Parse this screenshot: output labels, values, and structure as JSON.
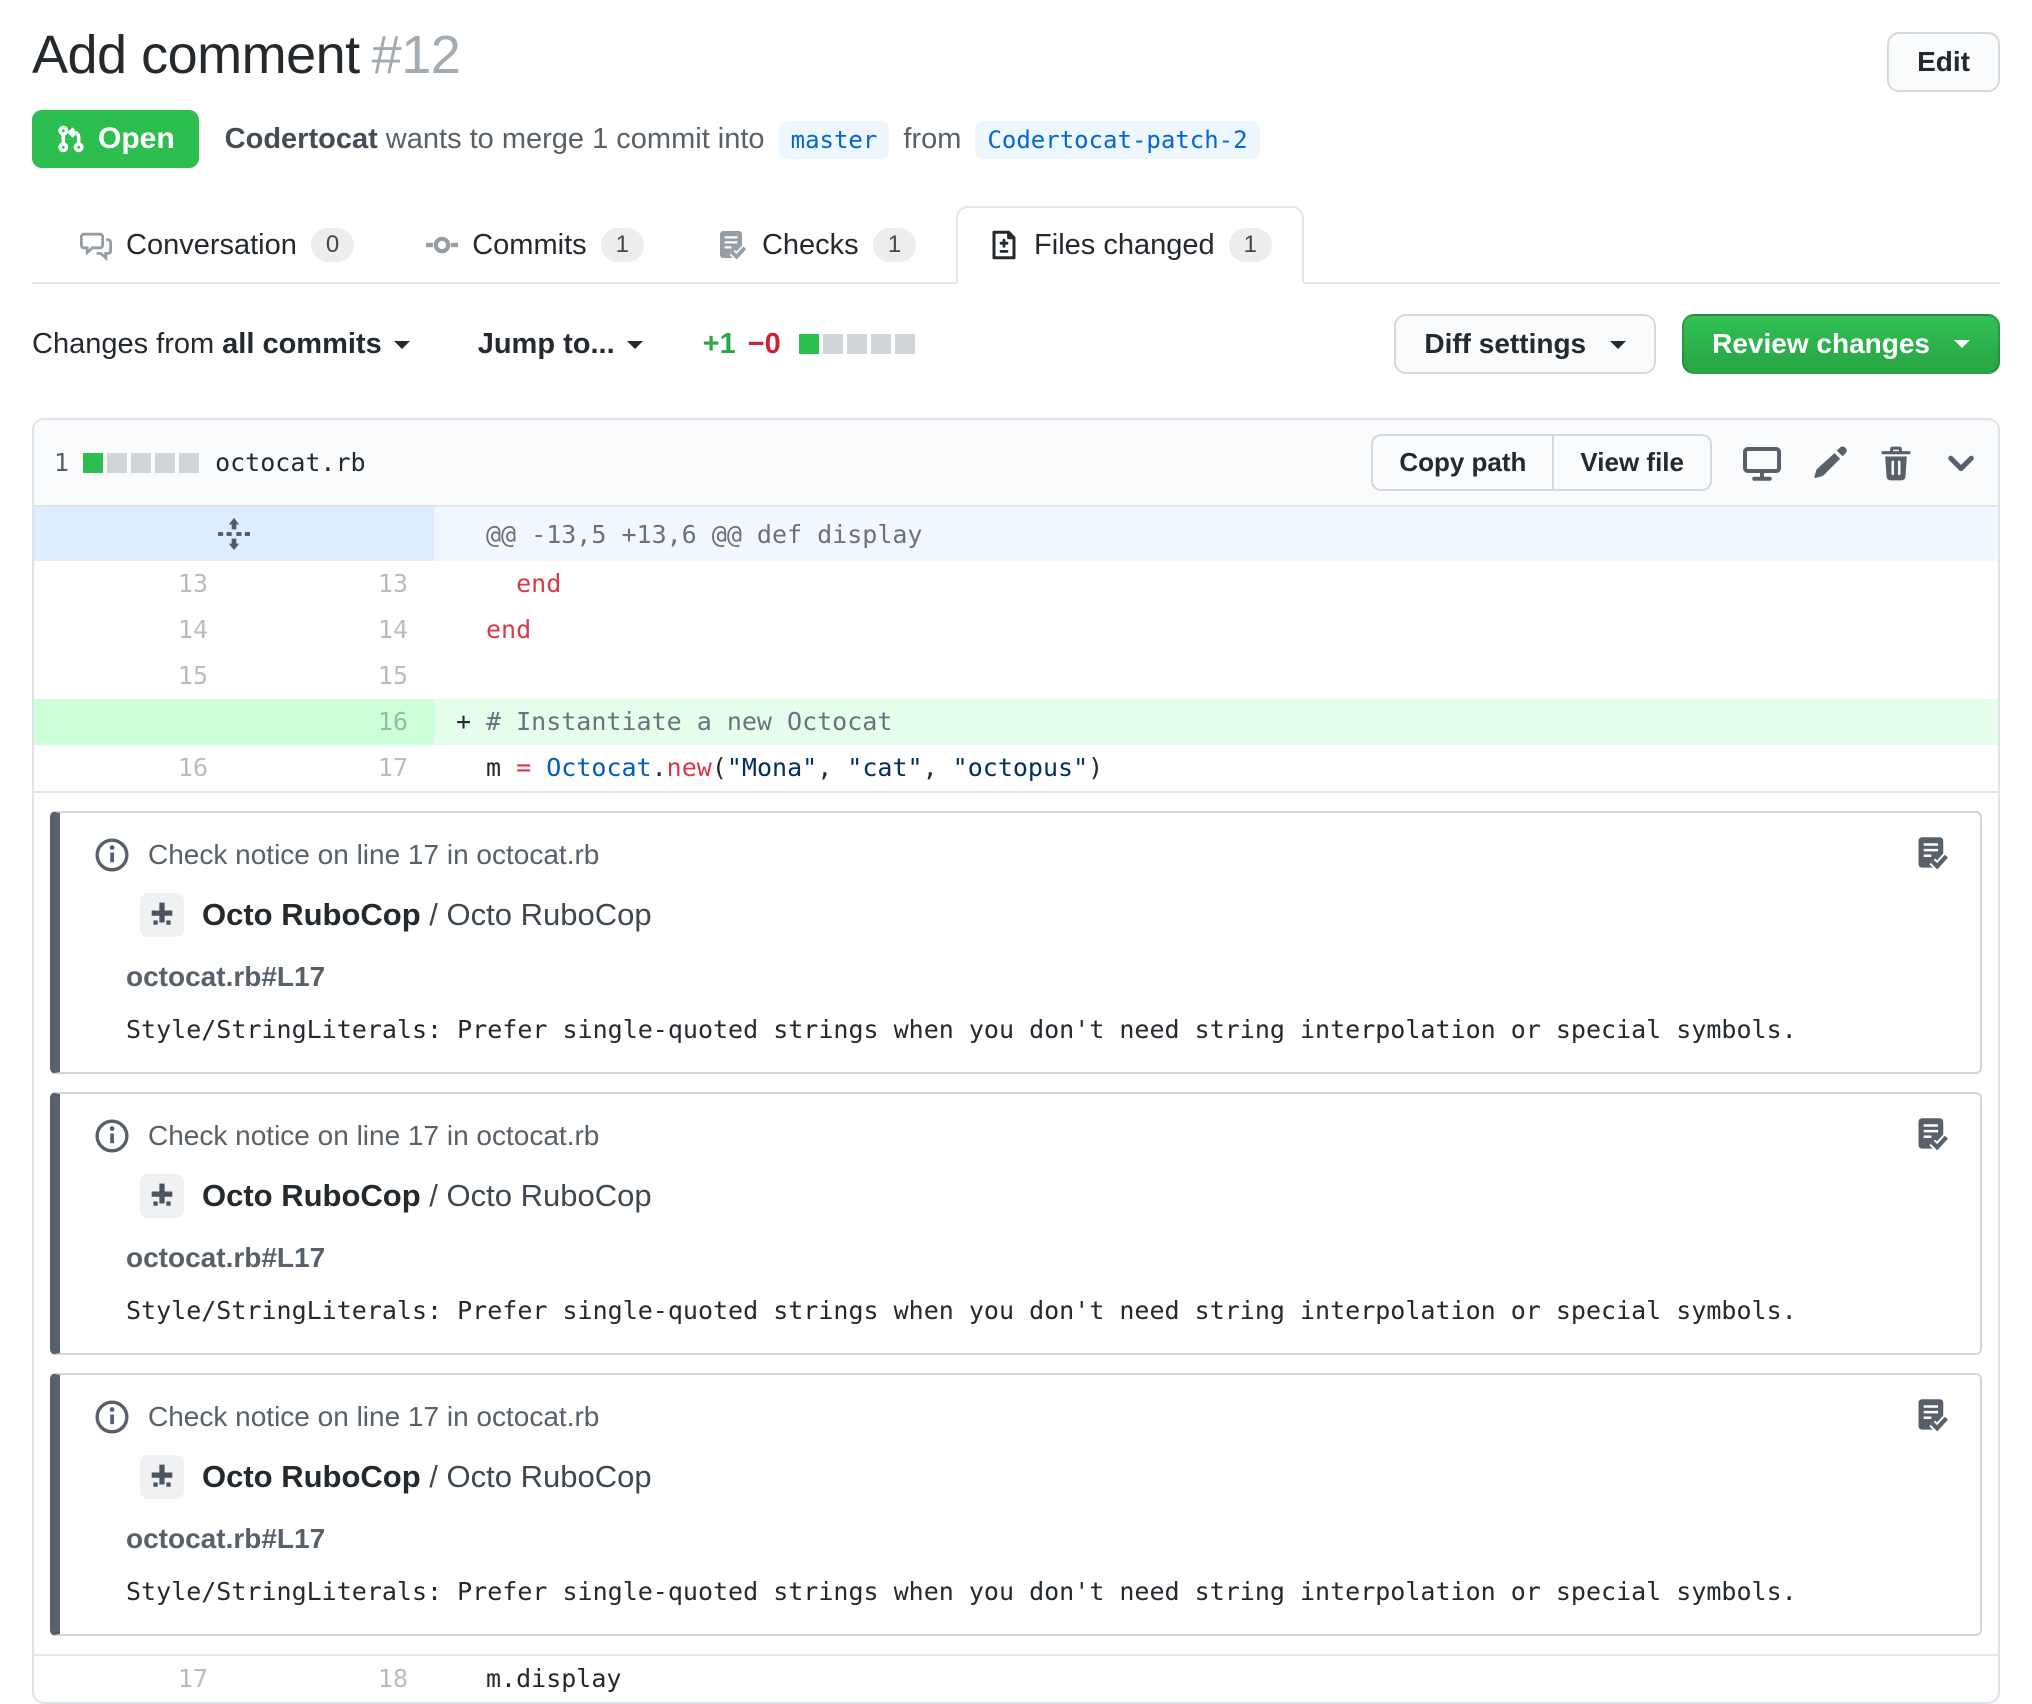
{
  "header": {
    "title": "Add comment",
    "number": "#12",
    "edit_label": "Edit"
  },
  "meta": {
    "state_label": "Open",
    "author": "Codertocat",
    "text_mid": " wants to merge 1 commit into ",
    "base_branch": "master",
    "text_from": " from ",
    "head_branch": "Codertocat-patch-2"
  },
  "tabs": [
    {
      "label": "Conversation",
      "count": "0",
      "icon": "comment-discussion-icon",
      "active": false
    },
    {
      "label": "Commits",
      "count": "1",
      "icon": "git-commit-icon",
      "active": false
    },
    {
      "label": "Checks",
      "count": "1",
      "icon": "checklist-icon",
      "active": false
    },
    {
      "label": "Files changed",
      "count": "1",
      "icon": "file-diff-icon",
      "active": true
    }
  ],
  "toolbar": {
    "changes_from_prefix": "Changes from",
    "changes_from_value": "all commits",
    "jump_to": "Jump to...",
    "additions": "+1",
    "deletions": "−0",
    "diffstat_blocks": {
      "green": 1,
      "gray": 4
    },
    "diff_settings": "Diff settings",
    "review_changes": "Review changes"
  },
  "file": {
    "stat_count": "1",
    "stat_blocks": {
      "green": 1,
      "gray": 4
    },
    "name": "octocat.rb",
    "copy_path": "Copy path",
    "view_file": "View file"
  },
  "diff": {
    "hunk": {
      "header": "@@ -13,5 +13,6 @@ def display"
    },
    "rows": [
      {
        "old": "13",
        "new": "13",
        "type": "context",
        "sign": " ",
        "segments": [
          {
            "c": "red",
            "t": "  end"
          }
        ]
      },
      {
        "old": "14",
        "new": "14",
        "type": "context",
        "sign": " ",
        "segments": [
          {
            "c": "red",
            "t": "end"
          }
        ]
      },
      {
        "old": "15",
        "new": "15",
        "type": "context",
        "sign": " ",
        "segments": []
      },
      {
        "old": "",
        "new": "16",
        "type": "addition",
        "sign": "+",
        "segments": [
          {
            "c": "comment",
            "t": "# Instantiate a new Octocat"
          }
        ]
      },
      {
        "old": "16",
        "new": "17",
        "type": "context",
        "sign": " ",
        "segments": [
          {
            "c": "plain",
            "t": "m "
          },
          {
            "c": "red",
            "t": "="
          },
          {
            "c": "plain",
            "t": " "
          },
          {
            "c": "blue",
            "t": "Octocat"
          },
          {
            "c": "plain",
            "t": "."
          },
          {
            "c": "red",
            "t": "new"
          },
          {
            "c": "plain",
            "t": "("
          },
          {
            "c": "string",
            "t": "\"Mona\""
          },
          {
            "c": "plain",
            "t": ", "
          },
          {
            "c": "string",
            "t": "\"cat\""
          },
          {
            "c": "plain",
            "t": ", "
          },
          {
            "c": "string",
            "t": "\"octopus\""
          },
          {
            "c": "plain",
            "t": ")"
          }
        ]
      }
    ],
    "tail_row": {
      "old": "17",
      "new": "18",
      "type": "context",
      "sign": " ",
      "segments": [
        {
          "c": "plain",
          "t": "m.display"
        }
      ]
    }
  },
  "annotations": [
    {
      "header": "Check notice on line 17 in octocat.rb",
      "app_bold": "Octo RuboCop",
      "app_sep": " / ",
      "app_rest": "Octo RuboCop",
      "location": "octocat.rb#L17",
      "message": "Style/StringLiterals: Prefer single-quoted strings when you don't need string interpolation or special symbols."
    },
    {
      "header": "Check notice on line 17 in octocat.rb",
      "app_bold": "Octo RuboCop",
      "app_sep": " / ",
      "app_rest": "Octo RuboCop",
      "location": "octocat.rb#L17",
      "message": "Style/StringLiterals: Prefer single-quoted strings when you don't need string interpolation or special symbols."
    },
    {
      "header": "Check notice on line 17 in octocat.rb",
      "app_bold": "Octo RuboCop",
      "app_sep": " / ",
      "app_rest": "Octo RuboCop",
      "location": "octocat.rb#L17",
      "message": "Style/StringLiterals: Prefer single-quoted strings when you don't need string interpolation or special symbols."
    }
  ],
  "icons": {
    "state_badge": "git-pull-request-icon",
    "hunk_gutter": "unfold-icon",
    "file_actions": [
      "display-rich-diff-icon",
      "edit-file-icon",
      "delete-file-icon",
      "chevron-down-icon"
    ],
    "annotation": [
      "info-icon",
      "checks-icon"
    ],
    "avatar": "octo-rubocop-plus-logo"
  },
  "colors": {
    "open_green": "#2cbe4e",
    "button_green": "#28a745",
    "addition_bg": "#e6ffed",
    "addition_gutter_bg": "#cdffd8",
    "hunk_bg": "#f1f8ff",
    "hunk_gutter_bg": "#dbedff",
    "link_blue": "#0366d6",
    "danger_red": "#cb2431",
    "syntax_red": "#d73a49",
    "syntax_blue": "#005cc5",
    "syntax_string": "#032f62",
    "annotation_bar": "#586069"
  }
}
